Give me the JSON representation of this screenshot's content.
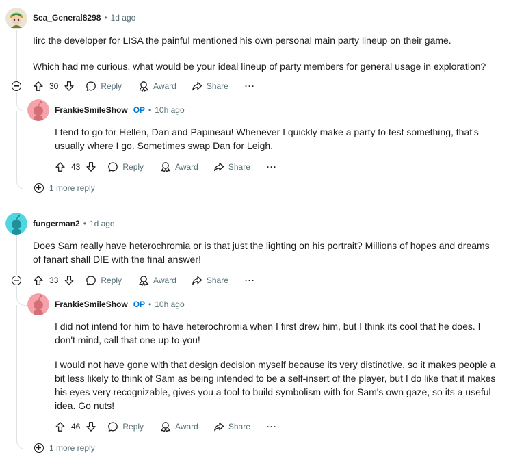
{
  "comments": [
    {
      "username": "Sea_General8298",
      "dot": "•",
      "time": "1d ago",
      "paragraphs": [
        "Iirc the developer for LISA the painful mentioned his own personal main party lineup on their game.",
        "Which had me curious, what would be your ideal lineup of party members for general usage in exploration?"
      ],
      "score": "30",
      "reply": "Reply",
      "award": "Award",
      "share": "Share",
      "more": "···",
      "child": {
        "username": "FrankieSmileShow",
        "op": "OP",
        "dot": "•",
        "time": "10h ago",
        "paragraphs": [
          "I tend to go for Hellen, Dan and Papineau! Whenever I quickly make a party to test something, that's usually where I go. Sometimes swap Dan for Leigh."
        ],
        "score": "43",
        "reply": "Reply",
        "award": "Award",
        "share": "Share",
        "more": "···"
      },
      "more_replies": "1 more reply"
    },
    {
      "username": "fungerman2",
      "dot": "•",
      "time": "1d ago",
      "paragraphs": [
        "Does Sam really have heterochromia or is that just the lighting on his portrait? Millions of hopes and dreams of fanart shall DIE with the final answer!"
      ],
      "score": "33",
      "reply": "Reply",
      "award": "Award",
      "share": "Share",
      "more": "···",
      "child": {
        "username": "FrankieSmileShow",
        "op": "OP",
        "dot": "•",
        "time": "10h ago",
        "paragraphs": [
          "I did not intend for him to have heterochromia when I first drew him, but I think its cool that he does. I don't mind, call that one up to you!",
          "I would not have gone with that design decision myself because its very distinctive, so it makes people a bit less likely to think of Sam as being intended to be a self-insert of the player, but I do like that it makes his eyes very recognizable, gives you a tool to build symbolism with for Sam's own gaze, so its a useful idea. Go nuts!"
        ],
        "score": "46",
        "reply": "Reply",
        "award": "Award",
        "share": "Share",
        "more": "···"
      },
      "more_replies": "1 more reply"
    }
  ],
  "colors": {
    "text": "#1c1c1c",
    "meta": "#576f76",
    "op": "#0079d3",
    "thread_line": "#dfe3e6",
    "avatar_pink": "#f5a3a8",
    "avatar_teal": "#4fd6e0"
  },
  "icons": [
    "upvote-icon",
    "downvote-icon",
    "reply-icon",
    "award-icon",
    "share-icon",
    "more-icon",
    "collapse-icon",
    "expand-icon"
  ]
}
